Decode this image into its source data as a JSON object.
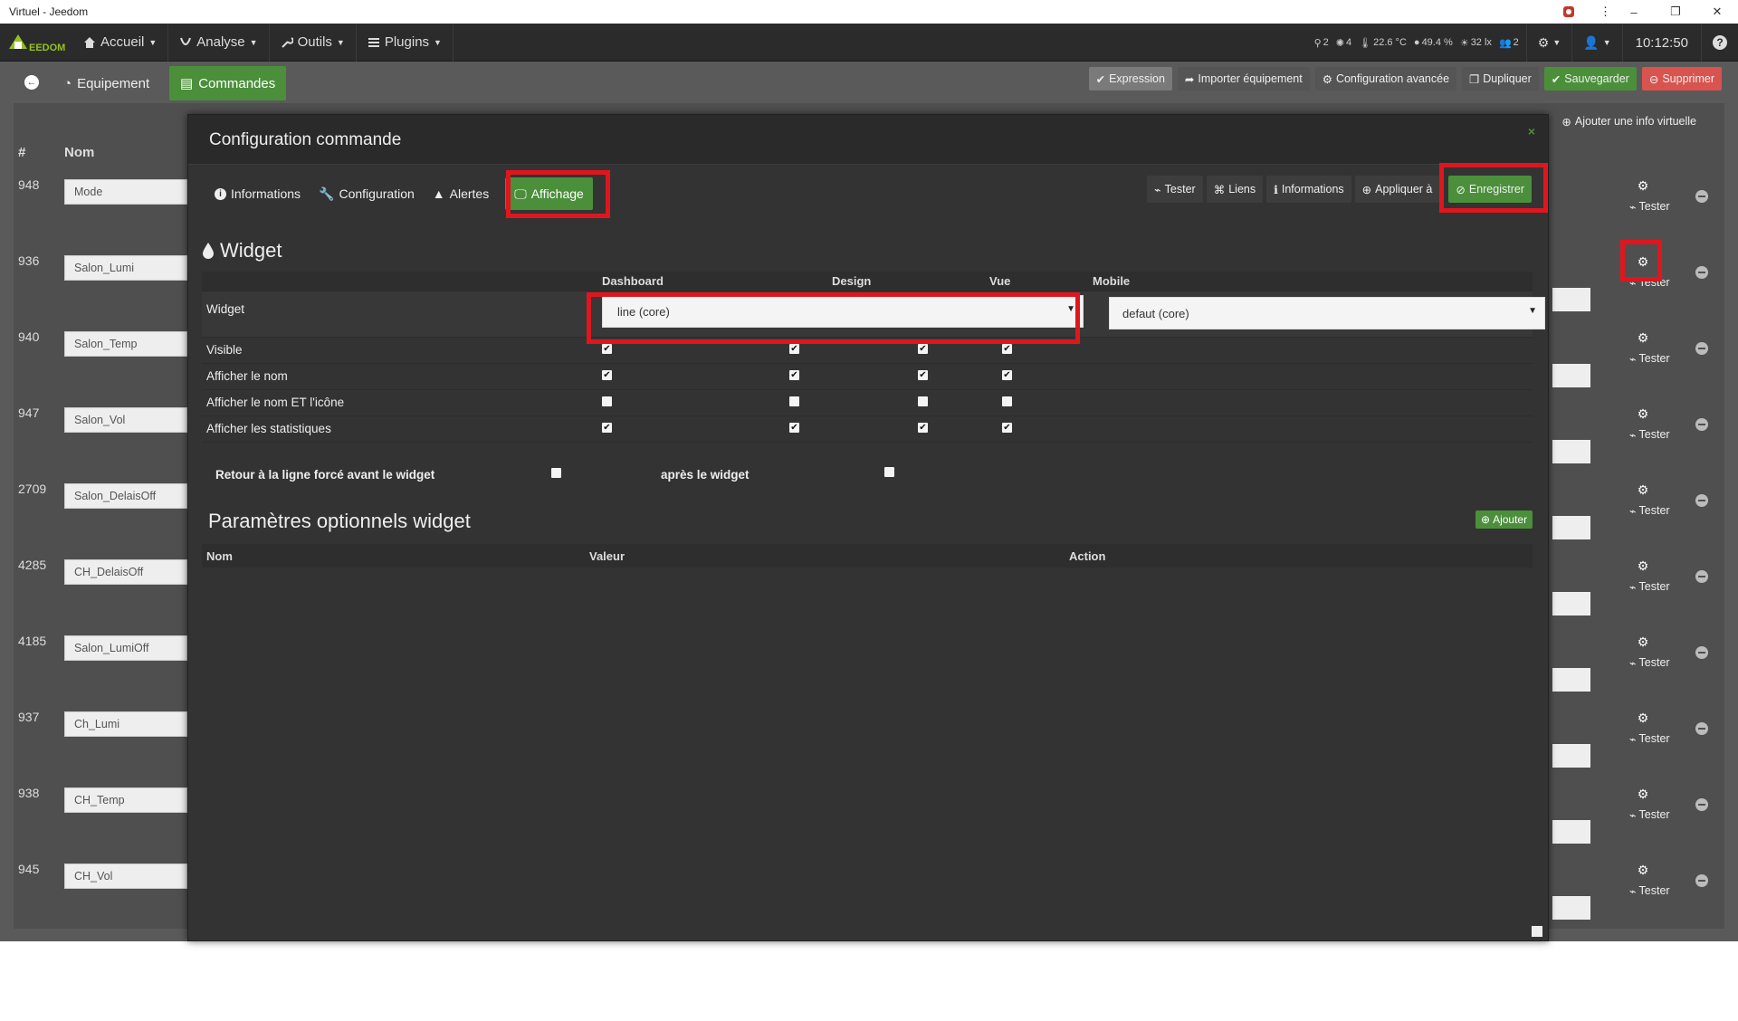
{
  "window": {
    "title": "Virtuel - Jeedom",
    "menu_glyph": "⋮",
    "minimize": "–",
    "restore": "❐",
    "close": "✕"
  },
  "navbar": {
    "logo": "JEEDOM",
    "menus": [
      {
        "icon": "home-icon",
        "label": "Accueil"
      },
      {
        "icon": "analytics-icon",
        "label": "Analyse"
      },
      {
        "icon": "wrench-icon",
        "label": "Outils"
      },
      {
        "icon": "list-icon",
        "label": "Plugins"
      }
    ],
    "stats": {
      "motion": "2",
      "lights": "4",
      "temperature": "22.6 °C",
      "humidity": "49.4 %",
      "lux": "32 lx",
      "people": "2"
    },
    "time": "10:12:50",
    "help_glyph": "?"
  },
  "topbar": {
    "back_glyph": "←",
    "tab_equipment": "Equipement",
    "tab_commands": "Commandes",
    "actions": {
      "expression": "Expression",
      "import": "Importer équipement",
      "advanced": "Configuration avancée",
      "duplicate": "Dupliquer",
      "save": "Sauvegarder",
      "delete": "Supprimer"
    },
    "add_virtual_info": "Ajouter une info virtuelle"
  },
  "commands": {
    "header": {
      "num": "#",
      "name": "Nom"
    },
    "tester_label": "Tester",
    "rows": [
      {
        "id": "948",
        "name": "Mode"
      },
      {
        "id": "936",
        "name": "Salon_Lumi"
      },
      {
        "id": "940",
        "name": "Salon_Temp"
      },
      {
        "id": "947",
        "name": "Salon_Vol"
      },
      {
        "id": "2709",
        "name": "Salon_DelaisOff"
      },
      {
        "id": "4285",
        "name": "CH_DelaisOff"
      },
      {
        "id": "4185",
        "name": "Salon_LumiOff"
      },
      {
        "id": "937",
        "name": "Ch_Lumi"
      },
      {
        "id": "938",
        "name": "CH_Temp"
      },
      {
        "id": "945",
        "name": "CH_Vol"
      }
    ]
  },
  "modal": {
    "title": "Configuration commande",
    "close_glyph": "×",
    "tabs": [
      "Informations",
      "Configuration",
      "Alertes",
      "Affichage"
    ],
    "actions": {
      "tester": "Tester",
      "liens": "Liens",
      "informations": "Informations",
      "appliquer": "Appliquer à",
      "enregistrer": "Enregistrer"
    },
    "widget_section": {
      "title": "Widget",
      "columns": [
        "Dashboard",
        "Design",
        "Vue",
        "Mobile"
      ],
      "widget_label": "Widget",
      "dashboard_select": "line (core)",
      "mobile_select": "defaut (core)",
      "select_arrow": "▼",
      "rows": [
        {
          "label": "Visible",
          "checks": [
            true,
            true,
            true,
            true
          ]
        },
        {
          "label": "Afficher le nom",
          "checks": [
            true,
            true,
            true,
            true
          ]
        },
        {
          "label": "Afficher le nom ET l'icône",
          "checks": [
            false,
            false,
            false,
            false
          ]
        },
        {
          "label": "Afficher les statistiques",
          "checks": [
            true,
            true,
            true,
            true
          ]
        }
      ],
      "return_before": "Retour à la ligne forcé avant le widget",
      "return_after": "après le widget"
    },
    "optional": {
      "title": "Paramètres optionnels widget",
      "add": "Ajouter",
      "columns": [
        "Nom",
        "Valeur",
        "Action"
      ]
    }
  }
}
